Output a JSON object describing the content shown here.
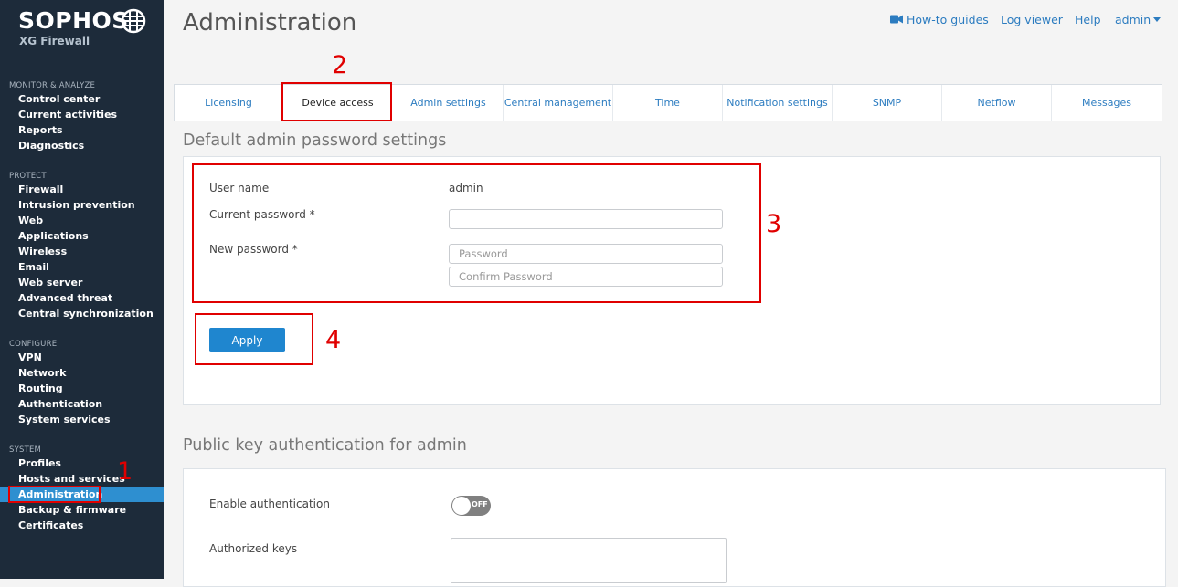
{
  "brand": {
    "name": "SOPHOS",
    "product": "XG Firewall"
  },
  "sidebar": {
    "sections": [
      {
        "title": "MONITOR & ANALYZE",
        "items": [
          "Control center",
          "Current activities",
          "Reports",
          "Diagnostics"
        ]
      },
      {
        "title": "PROTECT",
        "items": [
          "Firewall",
          "Intrusion prevention",
          "Web",
          "Applications",
          "Wireless",
          "Email",
          "Web server",
          "Advanced threat",
          "Central synchronization"
        ]
      },
      {
        "title": "CONFIGURE",
        "items": [
          "VPN",
          "Network",
          "Routing",
          "Authentication",
          "System services"
        ]
      },
      {
        "title": "SYSTEM",
        "items": [
          "Profiles",
          "Hosts and services",
          "Administration",
          "Backup & firmware",
          "Certificates"
        ]
      }
    ],
    "active_item": "Administration"
  },
  "header": {
    "title": "Administration",
    "links": {
      "howto": "How-to guides",
      "logviewer": "Log viewer",
      "help": "Help",
      "user": "admin"
    }
  },
  "tabs": [
    "Licensing",
    "Device access",
    "Admin settings",
    "Central management",
    "Time",
    "Notification settings",
    "SNMP",
    "Netflow",
    "Messages"
  ],
  "active_tab": "Device access",
  "password_section": {
    "title": "Default admin password settings",
    "username_label": "User name",
    "username_value": "admin",
    "current_label": "Current password *",
    "current_value": "",
    "new_label": "New password *",
    "new_placeholder": "Password",
    "confirm_placeholder": "Confirm Password",
    "apply_label": "Apply"
  },
  "pubkey_section": {
    "title": "Public key authentication for admin",
    "enable_label": "Enable authentication",
    "toggle_state": "OFF",
    "keys_label": "Authorized keys"
  },
  "annotations": [
    "1",
    "2",
    "3",
    "4"
  ],
  "colors": {
    "sidebar_bg": "#1d2b3a",
    "accent": "#2e8fd0",
    "link": "#2c7cc0",
    "highlight": "#e00000",
    "toggle_off": "#808080"
  }
}
